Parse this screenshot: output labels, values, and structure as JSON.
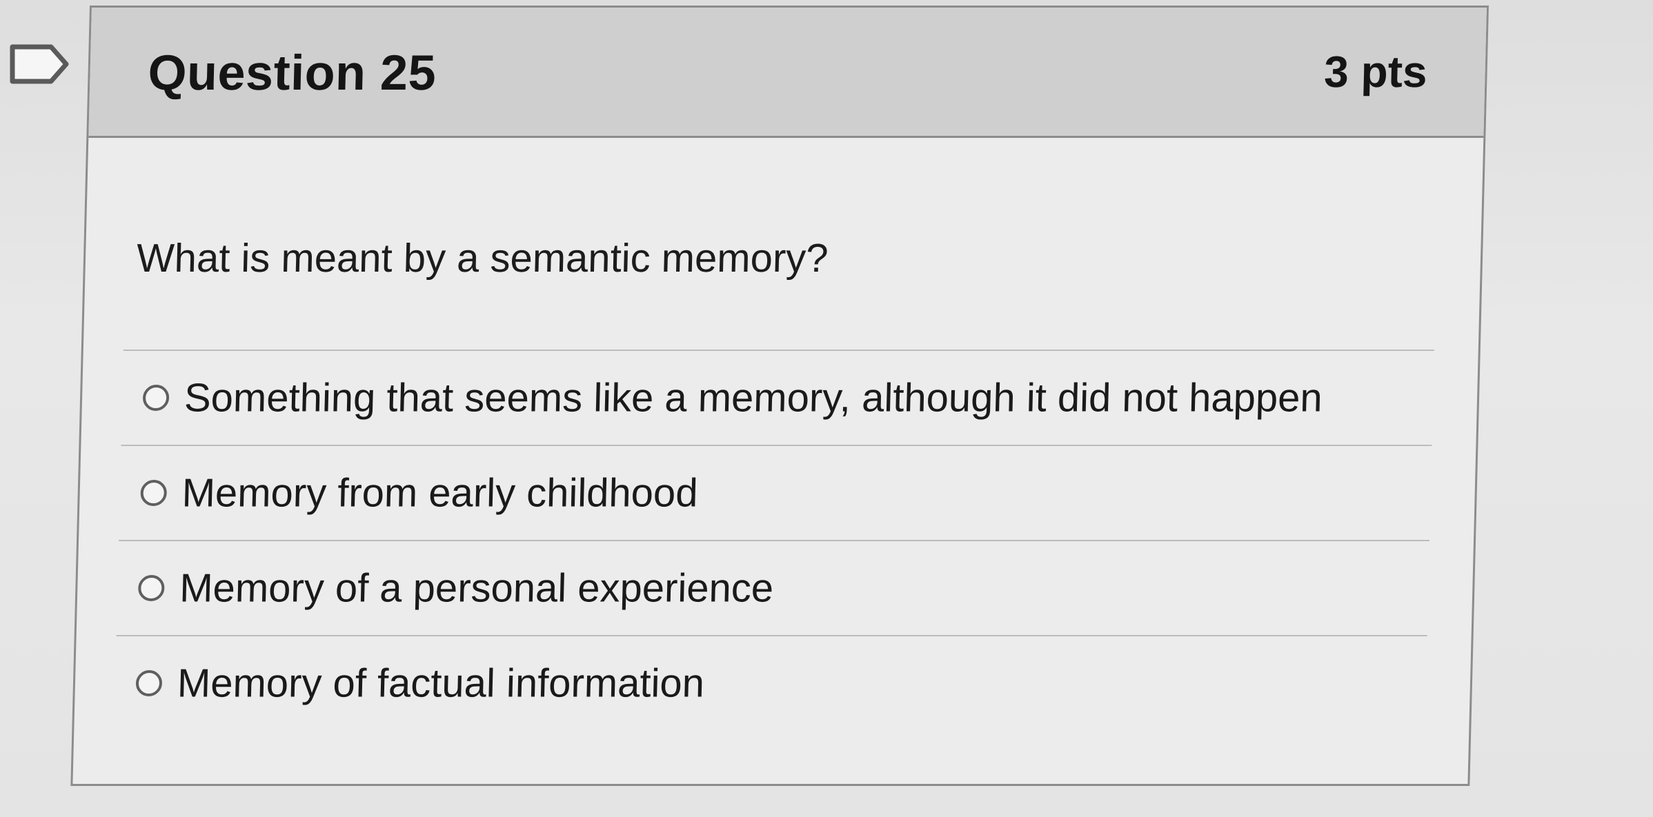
{
  "question": {
    "title": "Question 25",
    "points": "3 pts",
    "prompt": "What is meant by a semantic memory?"
  },
  "answers": [
    {
      "label": "Something that seems like a memory, although it did not happen"
    },
    {
      "label": "Memory from early childhood"
    },
    {
      "label": "Memory of a personal experience"
    },
    {
      "label": "Memory of factual information"
    }
  ],
  "icons": {
    "flag": "flag-icon",
    "radio": "radio-button-icon"
  },
  "colors": {
    "header_bg": "#cfcfcf",
    "card_bg": "#ececec",
    "border": "#8c8c8c"
  }
}
